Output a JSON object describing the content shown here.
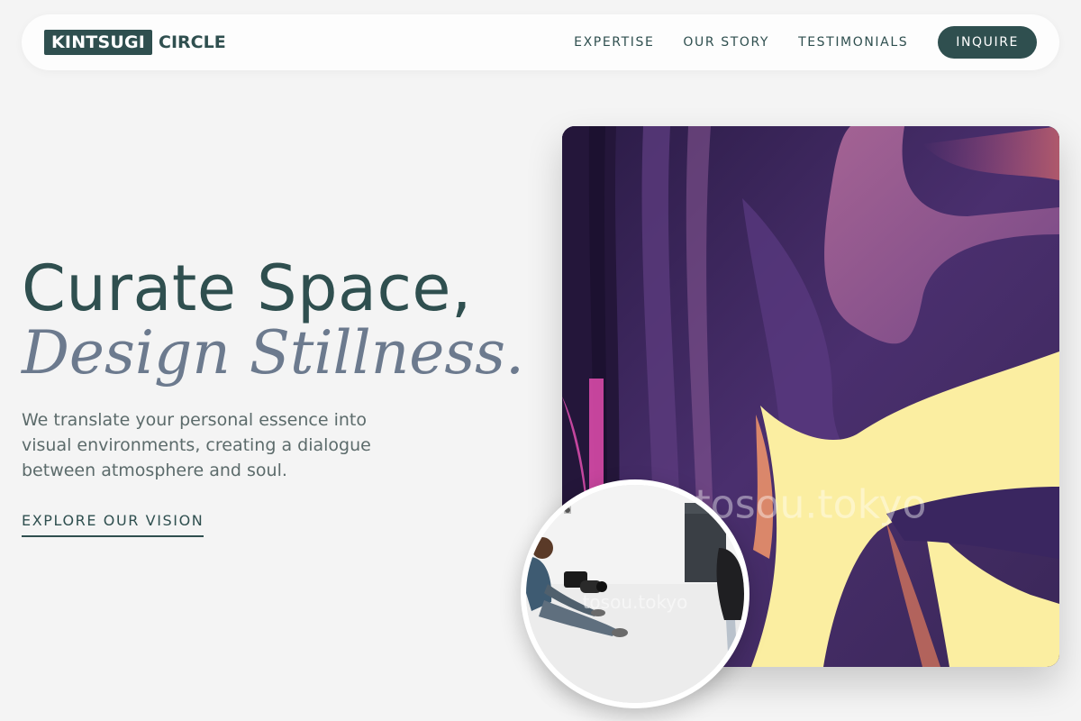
{
  "brand": {
    "logo_box": "KINTSUGI",
    "logo_word": "CIRCLE"
  },
  "nav": {
    "links": [
      "EXPERTISE",
      "OUR STORY",
      "TESTIMONIALS"
    ],
    "cta": "INQUIRE"
  },
  "hero": {
    "title_line1": "Curate Space,",
    "title_line2": "Design Stillness.",
    "description": "We translate your personal essence into visual environments, creating a dialogue between atmosphere and soul.",
    "link": "EXPLORE OUR VISION"
  },
  "media": {
    "main_watermark": "tosou.tokyo",
    "circle_watermark": "tosou.tokyo"
  },
  "colors": {
    "accent": "#2f4f4f",
    "page_bg": "#f4f4f4",
    "subtitle": "#6c7a8e"
  }
}
